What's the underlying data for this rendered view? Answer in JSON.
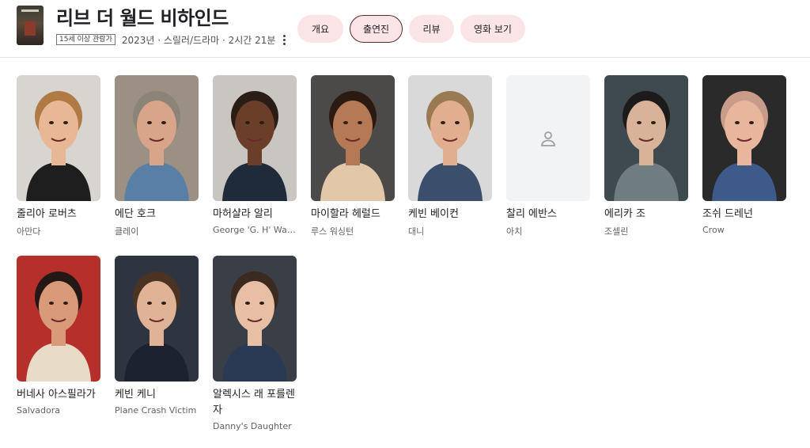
{
  "movie": {
    "title": "리브 더 월드 비하인드",
    "age_rating": "15세 이상 관람가",
    "meta": "2023년 · 스릴러/드라마 · 2시간 21분"
  },
  "tabs": [
    {
      "label": "개요"
    },
    {
      "label": "출연진"
    },
    {
      "label": "리뷰"
    },
    {
      "label": "영화 보기"
    }
  ],
  "cast": [
    {
      "name": "줄리아 로버츠",
      "role": "아만다",
      "skin": "#e8b896",
      "hair": "#b07a45",
      "bg": "#d8d4cf",
      "shirt": "#1e1e1e"
    },
    {
      "name": "에단 호크",
      "role": "클레이",
      "skin": "#d9a58a",
      "hair": "#8d8478",
      "bg": "#9c8f84",
      "shirt": "#5a7fa6"
    },
    {
      "name": "마허샬라 알리",
      "role": "George 'G. H' Washington",
      "skin": "#6a3e28",
      "hair": "#2a1d16",
      "bg": "#c9c5c0",
      "shirt": "#1f2a3a"
    },
    {
      "name": "마이할라 헤럴드",
      "role": "루스 워싱턴",
      "skin": "#b57a55",
      "hair": "#2b1a12",
      "bg": "#4c4a48",
      "shirt": "#e2c7a8"
    },
    {
      "name": "케빈 베이컨",
      "role": "대니",
      "skin": "#e2ae90",
      "hair": "#9a7a52",
      "bg": "#d9d9d9",
      "shirt": "#3b4e6b"
    },
    {
      "name": "찰리 에반스",
      "role": "아치",
      "placeholder": true
    },
    {
      "name": "에리카 조",
      "role": "조셀린",
      "skin": "#d8b39a",
      "hair": "#1c1a1a",
      "bg": "#3f4a4e",
      "shirt": "#6f7d80"
    },
    {
      "name": "조쉬 드레넌",
      "role": "Crow",
      "skin": "#e8b59d",
      "hair": "#c89c88",
      "bg": "#2a2a2a",
      "shirt": "#3e5a8a"
    },
    {
      "name": "버네사 아스필라가",
      "role": "Salvadora",
      "skin": "#d99a7a",
      "hair": "#231815",
      "bg": "#b5302a",
      "shirt": "#e8dcc8"
    },
    {
      "name": "케빈 케니",
      "role": "Plane Crash Victim",
      "skin": "#e0b296",
      "hair": "#4a3322",
      "bg": "#2e3540",
      "shirt": "#1c2230"
    },
    {
      "name": "알렉시스 래 포를렌자",
      "role": "Danny's Daughter",
      "skin": "#e6bfa4",
      "hair": "#3a2a20",
      "bg": "#3a3f47",
      "shirt": "#2a3a55"
    }
  ]
}
